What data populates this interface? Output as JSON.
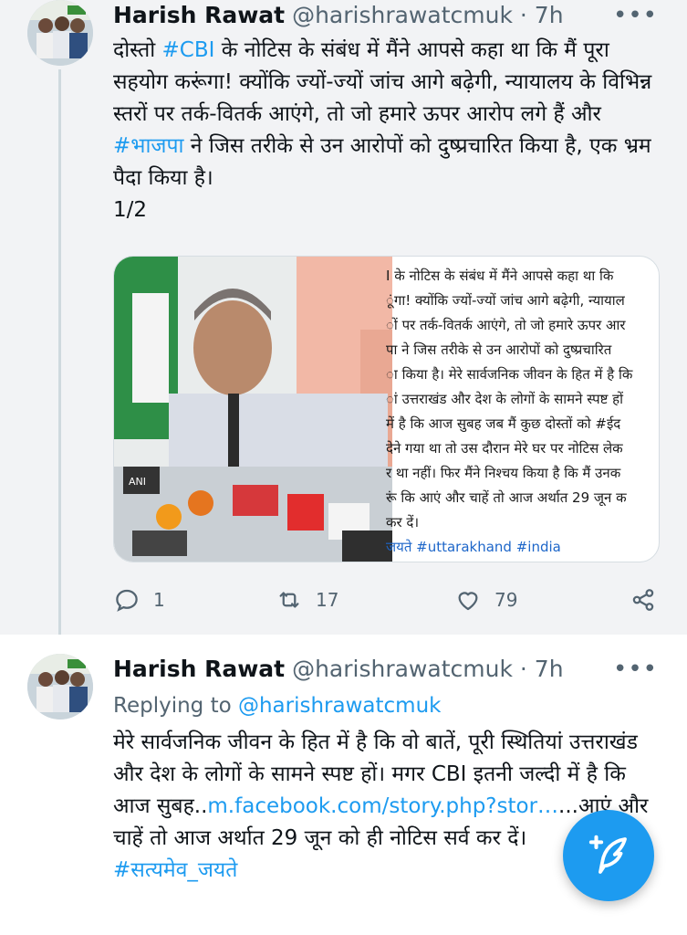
{
  "tweet1": {
    "author_name": "Harish Rawat",
    "handle": "@harishrawatcmuk",
    "dot": "·",
    "time": "7h",
    "more_icon": "more-horizontal-icon",
    "text_line1_a": "दोस्तो ",
    "tag_cbi": "#CBI",
    "text_line1_b": " के नोटिस के संबंध में मैंने आपसे कहा था कि मैं पूरा सहयोग करूंगा! क्योंकि ज्यों-ज्यों जांच आगे बढ़ेगी, न्यायालय के विभिन्न स्तरों पर तर्क-वितर्क आएंगे, तो जो हमारे ऊपर आरोप लगे हैं और ",
    "tag_bjp": "#भाजपा",
    "text_line2": " ने जिस तरीके से उन आरोपों को दुष्प्रचारित किया है, एक भ्रम पैदा किया है।",
    "thread_counter": "1/2",
    "media": {
      "lines": [
        "I के नोटिस के संबंध में मैंने आपसे कहा था कि",
        "ूंगा! क्योंकि ज्यों-ज्यों जांच आगे बढ़ेगी, न्यायाल",
        "ों पर तर्क-वितर्क आएंगे, तो जो हमारे ऊपर आर",
        "पा ने जिस तरीके से उन आरोपों को दुष्प्रचारित",
        "ा किया है। मेरे सार्वजनिक जीवन के हित में है कि",
        "ां उत्तराखंड और देश के लोगों के सामने स्पष्ट हों",
        "में है कि आज सुबह जब मैं कुछ दोस्तों को #ईद",
        "देने गया था तो उस दौरान मेरे घर पर नोटिस लेक",
        "र था नहीं। फिर मैंने निश्चय किया है कि मैं उनक",
        "रूं कि आएं और चाहें तो आज अर्थात 29 जून क",
        "कर दें।"
      ],
      "tags_line": "जयते #uttarakhand #india"
    },
    "actions": {
      "reply_count": "1",
      "retweet_count": "17",
      "like_count": "79"
    }
  },
  "tweet2": {
    "author_name": "Harish Rawat",
    "handle": "@harishrawatcmuk",
    "dot": "·",
    "time": "7h",
    "replying_prefix": "Replying to ",
    "replying_handle": "@harishrawatcmuk",
    "text_a": "मेरे सार्वजनिक जीवन के हित में है कि वो बातें, पूरी स्थितियां उत्तराखंड और देश के लोगों के सामने स्पष्ट हों। मगर CBI इतनी जल्दी में है कि आज सुबह..",
    "link": "m.facebook.com/story.php?stor…",
    "text_b": "...आएं और चाहें तो आज अर्थात 29 जून को ही नोटिस सर्व कर दें।",
    "tag": "#सत्यमेव_जयते"
  },
  "colors": {
    "accent": "#1d9bf0",
    "secondary_text": "#536471",
    "thread_bg": "#f2f3f5"
  },
  "fab_icon": "compose-tweet-icon"
}
